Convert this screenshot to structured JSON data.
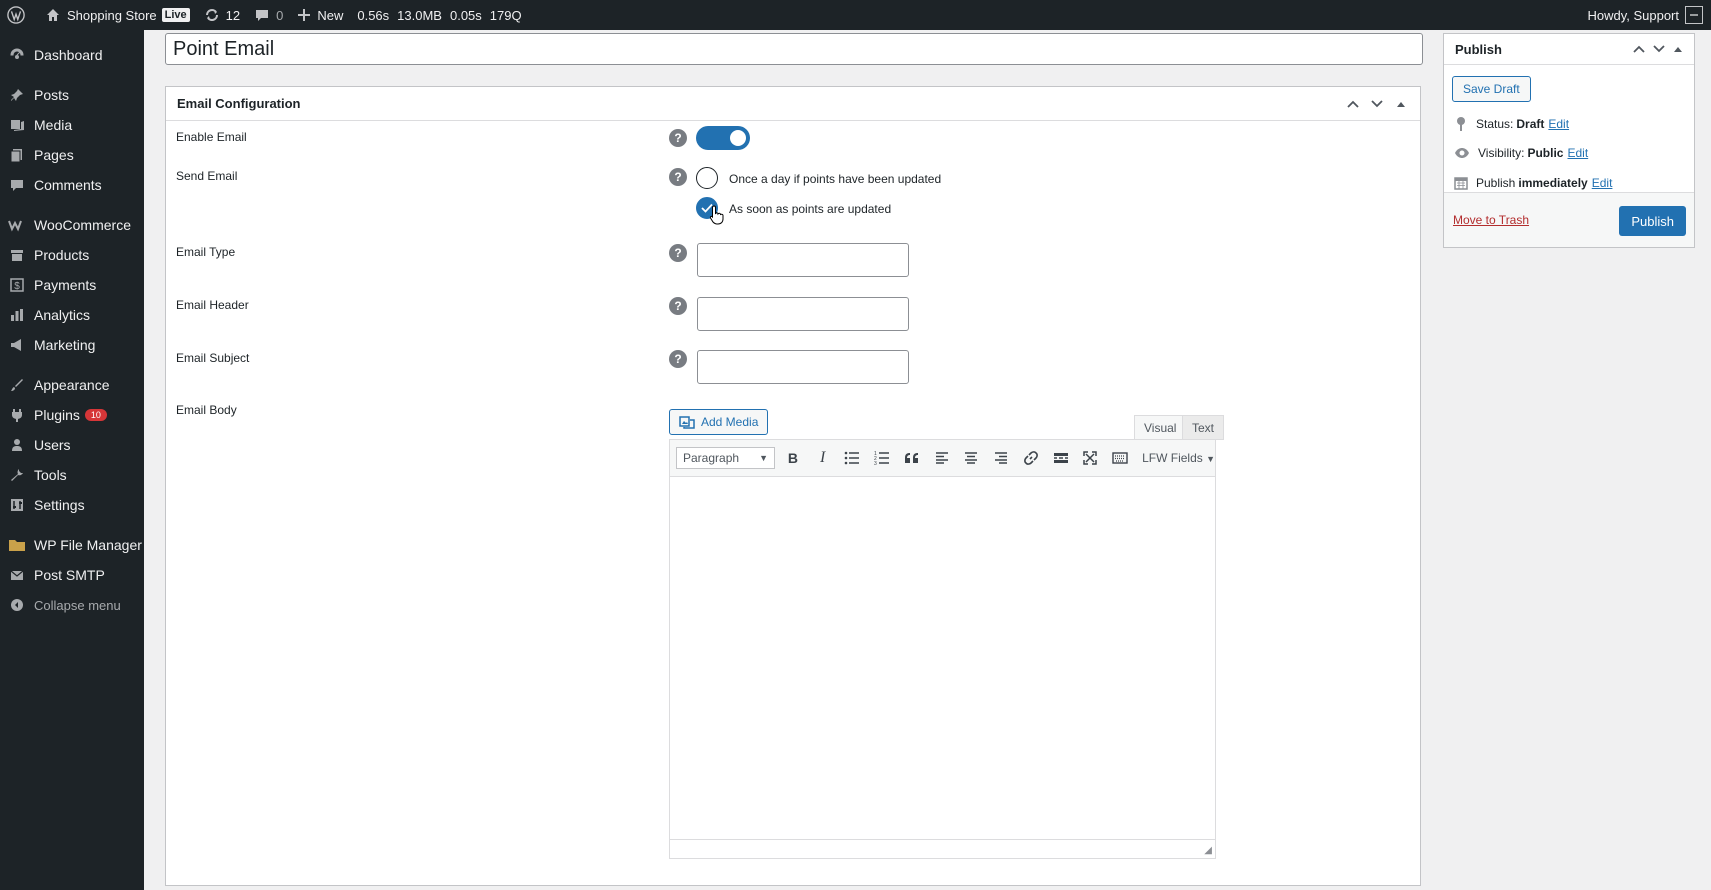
{
  "adminbar": {
    "site_name": "Shopping Store",
    "live_badge": "Live",
    "updates_count": "12",
    "comments_count": "0",
    "new_label": "New",
    "perf": [
      "0.56s",
      "13.0MB",
      "0.05s",
      "179Q"
    ],
    "howdy": "Howdy, Support"
  },
  "sidebar": {
    "items": [
      {
        "label": "Dashboard",
        "icon": "dashboard-icon"
      },
      {
        "label": "Posts",
        "icon": "pin-icon"
      },
      {
        "label": "Media",
        "icon": "media-icon"
      },
      {
        "label": "Pages",
        "icon": "pages-icon"
      },
      {
        "label": "Comments",
        "icon": "comments-icon"
      },
      {
        "label": "WooCommerce",
        "icon": "woocommerce-icon"
      },
      {
        "label": "Products",
        "icon": "products-icon"
      },
      {
        "label": "Payments",
        "icon": "payments-icon"
      },
      {
        "label": "Analytics",
        "icon": "analytics-icon"
      },
      {
        "label": "Marketing",
        "icon": "marketing-icon"
      },
      {
        "label": "Appearance",
        "icon": "appearance-icon"
      },
      {
        "label": "Plugins",
        "icon": "plugins-icon",
        "badge": "10"
      },
      {
        "label": "Users",
        "icon": "users-icon"
      },
      {
        "label": "Tools",
        "icon": "tools-icon"
      },
      {
        "label": "Settings",
        "icon": "settings-icon"
      },
      {
        "label": "WP File Manager",
        "icon": "folder-icon"
      },
      {
        "label": "Post SMTP",
        "icon": "mail-icon"
      }
    ],
    "collapse_label": "Collapse menu"
  },
  "post": {
    "title_value": "Point Email"
  },
  "config": {
    "box_title": "Email Configuration",
    "enable_label": "Enable Email",
    "enable_value": "on",
    "send_label": "Send Email",
    "send_option_1": "Once a day if points have been updated",
    "send_option_2": "As soon as points are updated",
    "send_selected": "As soon as points are updated",
    "type_label": "Email Type",
    "type_value": "",
    "header_label": "Email Header",
    "header_value": "",
    "subject_label": "Email Subject",
    "subject_value": "",
    "body_label": "Email Body",
    "add_media_label": "Add Media",
    "tab_visual": "Visual",
    "tab_text": "Text",
    "format_select": "Paragraph",
    "lfw_fields": "LFW Fields"
  },
  "publish": {
    "title": "Publish",
    "save_draft": "Save Draft",
    "status_label": "Status:",
    "status_value": "Draft",
    "visibility_label": "Visibility:",
    "visibility_value": "Public",
    "publish_label": "Publish",
    "publish_value": "immediately",
    "edit_label": "Edit",
    "trash_label": "Move to Trash",
    "publish_button": "Publish"
  },
  "colors": {
    "accent": "#2271b1",
    "admin_dark": "#1d2327",
    "danger": "#d63638"
  }
}
